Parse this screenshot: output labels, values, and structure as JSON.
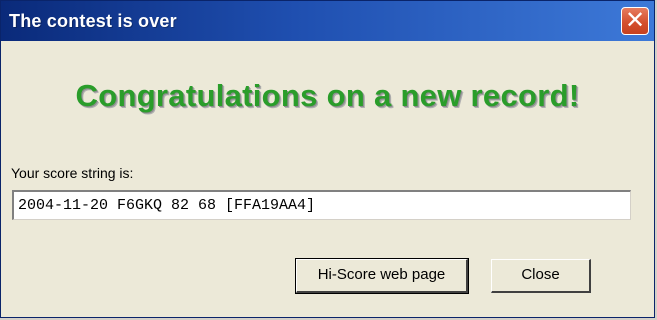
{
  "window": {
    "title": "The contest is over",
    "close_glyph": "✕",
    "close_icon": "close-icon"
  },
  "dialog": {
    "headline": "Congratulations on a new record!",
    "score_label": "Your score string is:",
    "score_value": "2004-11-20 F6GKQ 82 68 [FFA19AA4]"
  },
  "buttons": {
    "hiscore_label": "Hi-Score web page",
    "close_label": "Close"
  },
  "colors": {
    "titlebar": "#1f4fb0",
    "headline": "#2a9d2a",
    "close_button": "#d4502f",
    "dialog_background": "#ece9d8"
  }
}
